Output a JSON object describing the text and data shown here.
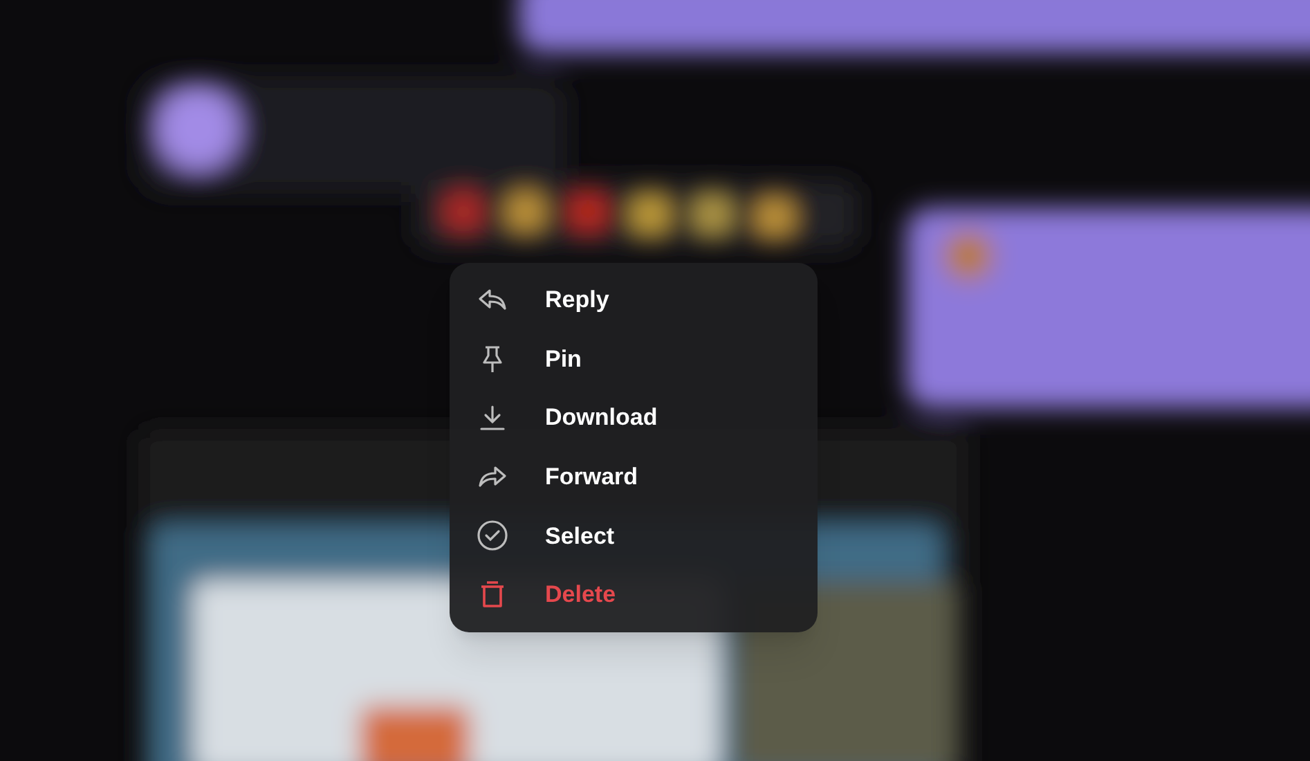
{
  "menu": {
    "items": [
      {
        "label": "Reply",
        "kind": "reply"
      },
      {
        "label": "Pin",
        "kind": "pin"
      },
      {
        "label": "Download",
        "kind": "download"
      },
      {
        "label": "Forward",
        "kind": "forward"
      },
      {
        "label": "Select",
        "kind": "select"
      },
      {
        "label": "Delete",
        "kind": "delete"
      }
    ]
  }
}
